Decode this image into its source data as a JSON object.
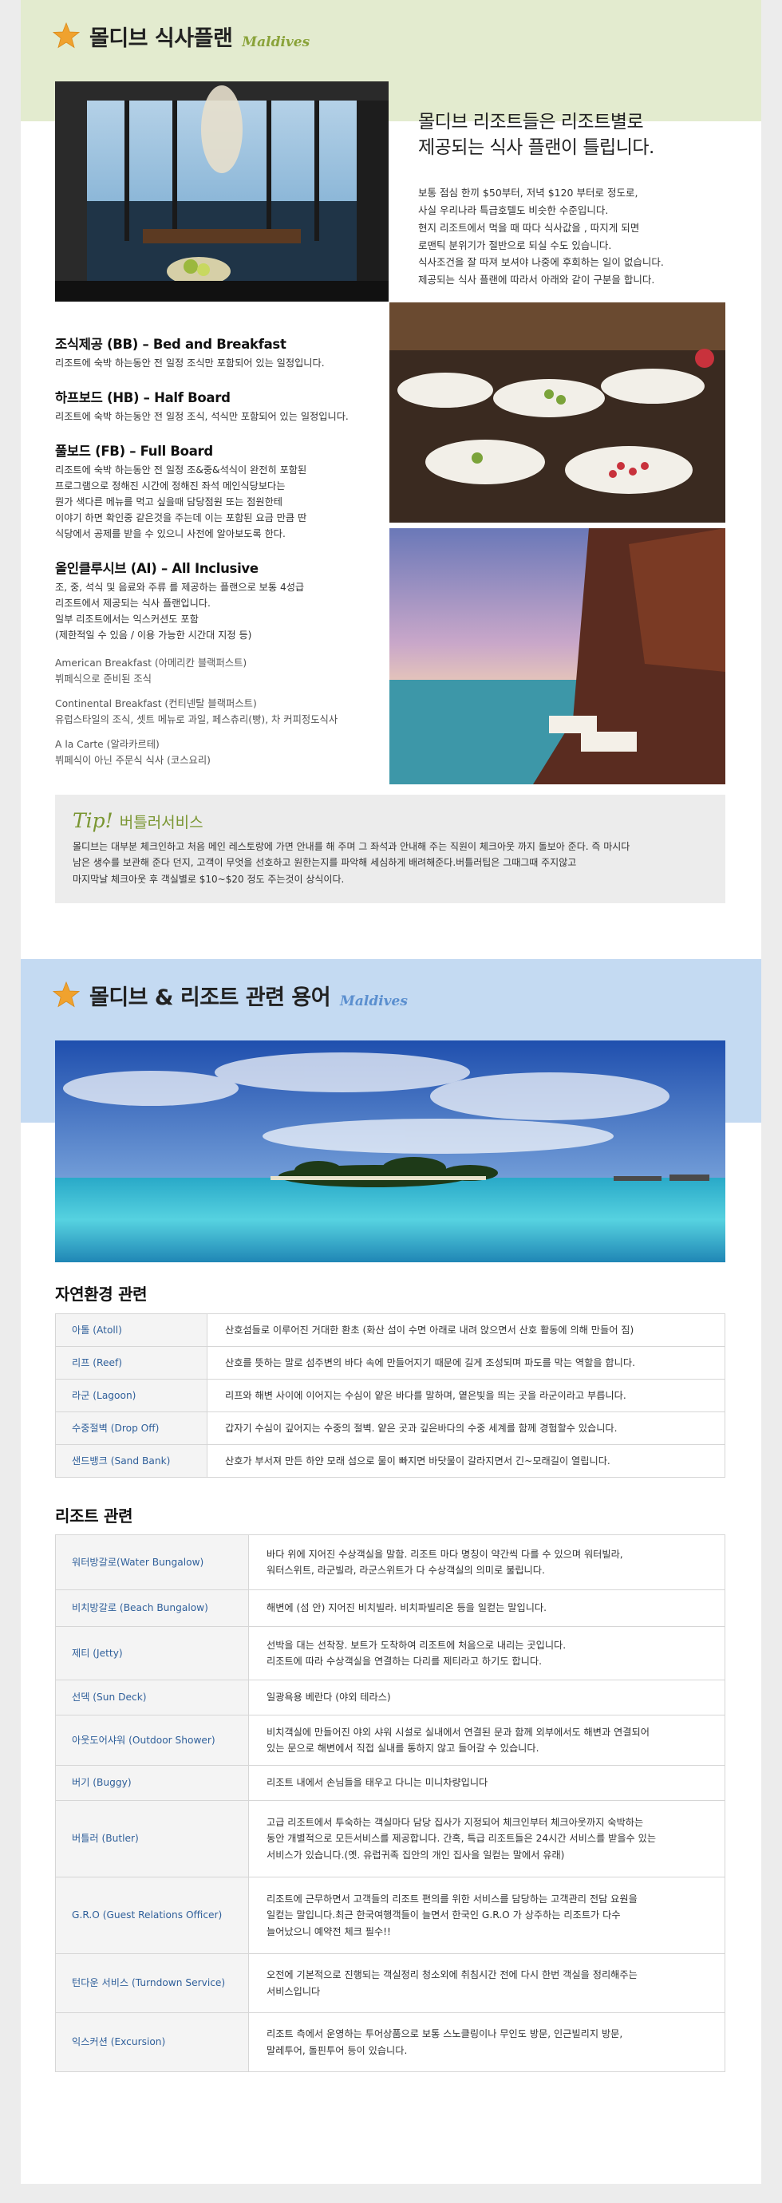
{
  "section1": {
    "title": "몰디브 식사플랜",
    "subtitle": "Maldives",
    "subtitle_color": "#8aa33a",
    "headline": "몰디브 리조트들은 리조트별로\n제공되는 식사 플랜이 틀립니다.",
    "intro": "보통 점심 한끼 $50부터, 저녁 $120 부터로 정도로,\n사실 우리나라 특급호텔도 비슷한 수준입니다.\n현지 리조트에서 먹을 때 따다 식사값을 , 따지게 되면\n로맨틱 분위기가 절반으로 되실 수도 있습니다.\n식사조건을 잘 따져 보셔야 나중에 후회하는 일이 없습니다.\n제공되는 식사 플랜에 따라서 아래와 같이 구분을 합니다.",
    "plans": [
      {
        "title": "조식제공 (BB) – Bed and Breakfast",
        "desc": "리조트에 숙박 하는동안 전 일정 조식만 포함되어 있는 일정입니다."
      },
      {
        "title": "하프보드 (HB) – Half Board",
        "desc": "리조트에 숙박 하는동안 전 일정 조식, 석식만 포함되어 있는 일정입니다."
      },
      {
        "title": "풀보드 (FB) – Full Board",
        "desc": "리조트에 숙박 하는동안 전 일정 조&중&석식이 완전히 포함된\n프로그램으로 정해진 시간에 정해진 좌석 메인식당보다는\n뭔가 색다른 메뉴를 먹고 싶을때 담당점원 또는 점원한테\n이야기 하면 확인중 같은것을 주는데 이는 포함된 요금 만큼 딴\n식당에서 공제를 받을 수 있으니 사전에 알아보도록 한다."
      },
      {
        "title": "올인클루시브 (AI) – All Inclusive",
        "desc": "조, 중, 석식 및 음료와 주류 를 제공하는 플랜으로 보통 4성급\n리조트에서 제공되는 식사 플랜입니다.\n일부 리조트에서는 익스커션도 포함\n(제한적일 수 있음 / 이용 가능한 시간대 지정 등)"
      }
    ],
    "breakfasts": [
      {
        "name": "American Breakfast (아메리칸 블랙퍼스트)",
        "desc": "뷔페식으로 준비된 조식"
      },
      {
        "name": "Continental Breakfast (컨티넨탈 블랙퍼스트)",
        "desc": "유럽스타일의 조식, 셋트 메뉴로 과일, 페스츄리(빵), 차 커피정도식사"
      },
      {
        "name": "A la Carte (알라카르테)",
        "desc": "뷔페식이 아닌 주문식 식사 (코스요리)"
      }
    ],
    "tip": {
      "label": "Tip!",
      "title": "버틀러서비스",
      "text": "몰디브는 대부분 체크인하고 처음 메인 레스토랑에 가면 안내를 해 주며 그 좌석과 안내해 주는 직원이 체크아웃 까지 돌보아 준다. 즉 마시다\n남은 생수를 보관해 준다 던지, 고객이 무엇을 선호하고 원한는지를 파악해 세심하게 배려해준다.버틀러팁은 그때그때 주지않고\n마지막날 체크아웃 후 객실별로 $10~$20 정도 주는것이 상식이다."
    }
  },
  "section2": {
    "title": "몰디브 & 리조트 관련 용어",
    "subtitle": "Maldives",
    "subtitle_color": "#5b8fcf",
    "nature_title": "자연환경 관련",
    "nature": [
      {
        "term": "아톨 (Atoll)",
        "desc": "산호섬들로 이루어진 거대한 환초 (화산 섬이 수면 아래로 내려 앉으면서 산호 활동에 의해 만들어 짐)"
      },
      {
        "term": "리프 (Reef)",
        "desc": "산호를 뜻하는 말로 섬주변의 바다 속에 만들어지기 때문에 길게 조성되며 파도를 막는 역할을 합니다."
      },
      {
        "term": "라군 (Lagoon)",
        "desc": "리프와 해변 사이에 이어지는 수심이 얕은 바다를 말하며, 옅은빛을 띄는 곳을 라군이라고 부릅니다."
      },
      {
        "term": "수중절벽 (Drop Off)",
        "desc": "갑자기 수심이 깊어지는 수중의 절벽. 얕은 곳과 깊은바다의 수중 세계를 함께 경험할수 있습니다."
      },
      {
        "term": "샌드뱅크 (Sand Bank)",
        "desc": "산호가 부서져 만든 하얀 모래 섬으로 물이 빠지면 바닷물이 갈라지면서 긴~모래길이 열립니다."
      }
    ],
    "resort_title": "리조트 관련",
    "resort": [
      {
        "term": "워터방갈로(Water Bungalow)",
        "desc": "바다 위에 지어진 수상객실을 말함. 리조트 마다 명칭이 약간씩 다를 수 있으며 워터빌라,\n워터스위트, 라군빌라, 라군스위트가 다 수상객실의 의미로 불립니다."
      },
      {
        "term": "비치방갈로 (Beach Bungalow)",
        "desc": "해변에 (섬 안) 지어진 비치빌라. 비치파빌리온 등을 일컫는 말입니다."
      },
      {
        "term": "제티 (Jetty)",
        "desc": "선박을 대는 선착장. 보트가 도착하여 리조트에 처음으로 내리는 곳입니다.\n리조트에 따라 수상객실을 연결하는 다리를 제티라고 하기도 합니다."
      },
      {
        "term": "선덱 (Sun Deck)",
        "desc": "일광욕용 베란다 (야외 테라스)"
      },
      {
        "term": "아웃도어샤워 (Outdoor Shower)",
        "desc": "비치객실에 만들어진 야외 샤워 시설로 실내에서 연결된 문과 함께 외부에서도 해변과 연결되어\n있는 문으로 해변에서 직접 실내를 통하지 않고 들어갈 수 있습니다."
      },
      {
        "term": "버기 (Buggy)",
        "desc": "리조트 내에서 손님들을 태우고 다니는 미니차량입니다"
      },
      {
        "term": "버틀러 (Butler)",
        "desc": "고급 리조트에서 투숙하는 객실마다 담당 집사가 지정되어 체크인부터 체크아웃까지 숙박하는\n동안 개별적으로 모든서비스를 제공합니다. 간혹, 특급 리조트들은 24시간 서비스를 받을수 있는\n서비스가 있습니다.(옛. 유럽귀족 집안의 개인 집사을 일컫는 말에서 유래)"
      },
      {
        "term": "G.R.O (Guest Relations Officer)",
        "desc": "리조트에 근무하면서 고객들의 리조트 편의를 위한 서비스를 담당하는 고객관리 전담 요원을\n일컫는 말입니다.최근 한국여행객들이 늘면서 한국인 G.R.O 가 상주하는 리조트가 다수\n늘어났으니 예약전 체크 필수!!"
      },
      {
        "term": "턴다운 서비스 (Turndown Service)",
        "desc": "오전에 기본적으로 진행되는 객실정리 청소외에 취침시간 전에 다시 한번 객실을 정리해주는\n서비스입니다"
      },
      {
        "term": "익스커션 (Excursion)",
        "desc": "리조트 측에서 운영하는 투어상품으로 보통 스노클링이나 무인도 방문, 인근빌리지 방문,\n말레투어, 돌핀투어 등이 있습니다."
      }
    ]
  },
  "icons": {
    "star": "star-icon"
  },
  "colors": {
    "section1_band": "#e3ebcf",
    "section2_band": "#c4daf2",
    "term_color": "#2f5f9a"
  }
}
